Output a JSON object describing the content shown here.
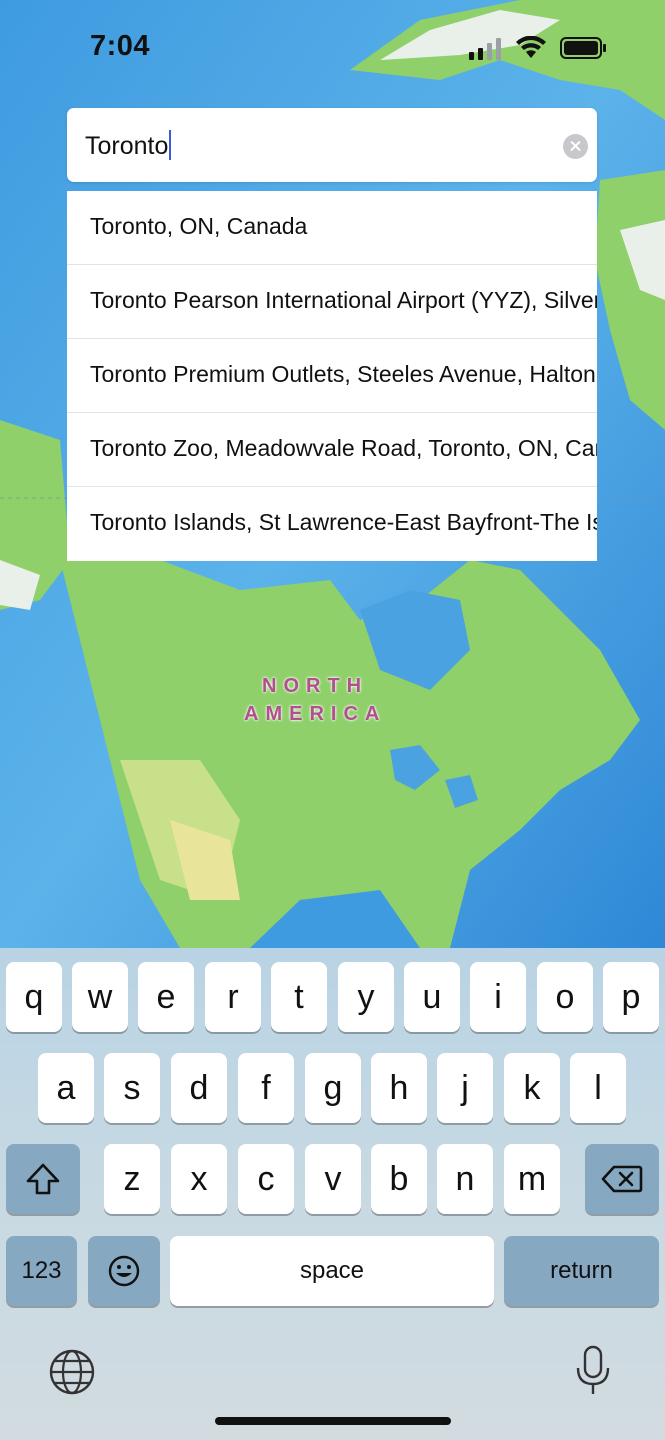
{
  "status_bar": {
    "time": "7:04"
  },
  "search": {
    "query": "Toronto"
  },
  "results": [
    "Toronto, ON, Canada",
    "Toronto Pearson International Airport (YYZ), Silver Dart Drive",
    "Toronto Premium Outlets, Steeles Avenue, Halton Hills",
    "Toronto Zoo, Meadowvale Road, Toronto, ON, Canada",
    "Toronto Islands, St Lawrence-East Bayfront-The Islands"
  ],
  "map": {
    "label_line1": "NORTH",
    "label_line2": "AMERICA",
    "colors": {
      "ocean": "#4aa3e0",
      "land": "#8fd06a",
      "arctic": "#e9f0ea"
    }
  },
  "keyboard": {
    "row1": [
      "q",
      "w",
      "e",
      "r",
      "t",
      "y",
      "u",
      "i",
      "o",
      "p"
    ],
    "row2": [
      "a",
      "s",
      "d",
      "f",
      "g",
      "h",
      "j",
      "k",
      "l"
    ],
    "row3": [
      "z",
      "x",
      "c",
      "v",
      "b",
      "n",
      "m"
    ],
    "numbers_label": "123",
    "space_label": "space",
    "return_label": "return",
    "icons": [
      "shift-icon",
      "delete-icon",
      "emoji-icon",
      "globe-icon",
      "microphone-icon"
    ]
  }
}
